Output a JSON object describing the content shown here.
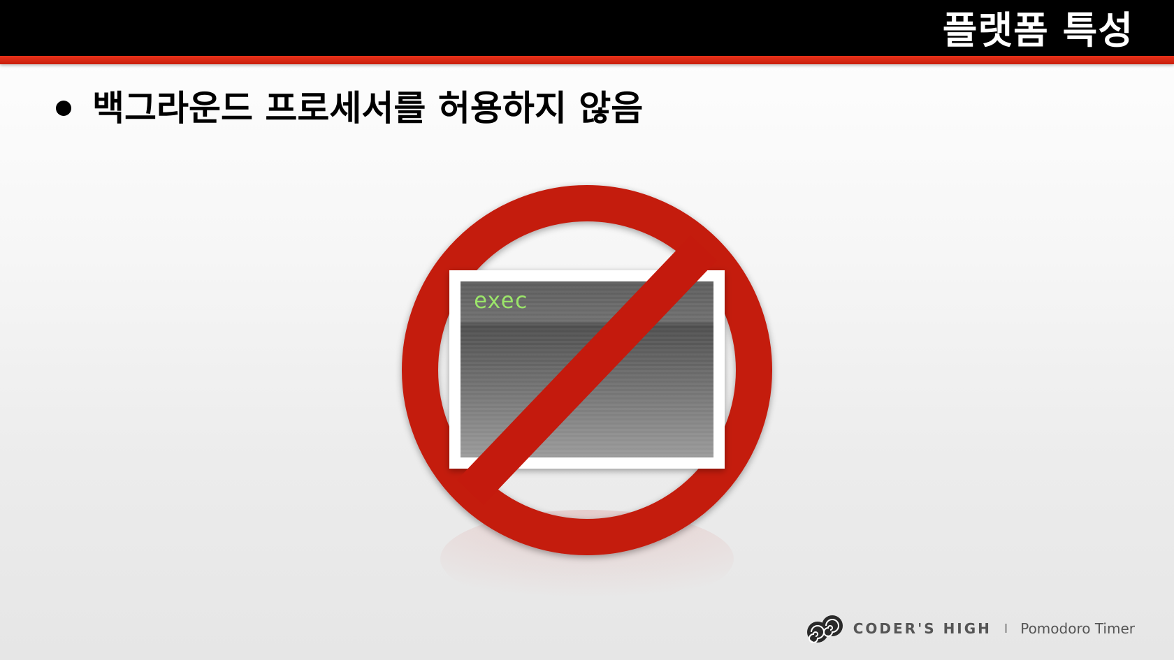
{
  "header": {
    "title": "플랫폼 특성"
  },
  "content": {
    "bullet": "백그라운드 프로세서를 허용하지 않음"
  },
  "illustration": {
    "terminal_text": "exec",
    "icon": "prohibited-terminal-icon",
    "colors": {
      "prohibition_red": "#c41a0d",
      "terminal_text": "#9be56a"
    }
  },
  "footer": {
    "logo": "coders-high-logo-icon",
    "brand": "CODER'S HIGH",
    "separator": "I",
    "product": "Pomodoro Timer"
  },
  "colors": {
    "header_bg": "#000000",
    "accent_stripe": "#d9260f"
  }
}
